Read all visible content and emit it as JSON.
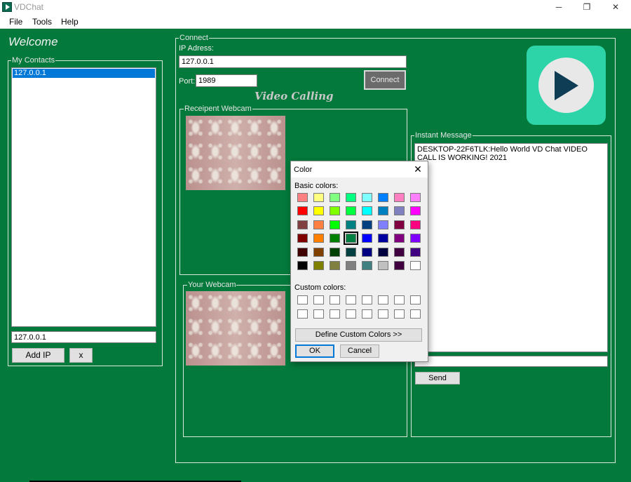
{
  "window": {
    "title": "VDChat",
    "minimize": "─",
    "maximize": "❐",
    "close": "✕"
  },
  "menu": [
    "File",
    "Tools",
    "Help"
  ],
  "welcome": "Welcome",
  "contacts": {
    "label": "My Contacts",
    "items": [
      "127.0.0.1"
    ],
    "ip_value": "127.0.0.1",
    "add_button": "Add IP",
    "remove_button": "x"
  },
  "connect": {
    "label": "Connect",
    "ip_label": "IP Adress:",
    "ip_value": "127.0.0.1",
    "port_label": "Port:",
    "port_value": "1989",
    "connect_button": "Connect",
    "video_title": "Video Calling",
    "recipient_webcam_label": "Receipent Webcam",
    "your_webcam_label": "Your Webcam"
  },
  "logo": {
    "icon": "play-icon",
    "bg_color": "#2cd4a8",
    "triangle_color": "#0f3d55"
  },
  "instant_message": {
    "label": "Instant Message",
    "text": "DESKTOP-22F6TLK:Hello World VD Chat VIDEO CALL IS WORKING! 2021",
    "input_value": "",
    "send_button": "Send"
  },
  "color_dialog": {
    "title": "Color",
    "close": "✕",
    "basic_label": "Basic colors:",
    "custom_label": "Custom colors:",
    "basic_colors": [
      [
        "#ff8080",
        "#ffff80",
        "#80ff80",
        "#00ff80",
        "#80ffff",
        "#0080ff",
        "#ff80c0",
        "#ff80ff"
      ],
      [
        "#ff0000",
        "#ffff00",
        "#80ff00",
        "#00ff40",
        "#00ffff",
        "#0080c0",
        "#8080c0",
        "#ff00ff"
      ],
      [
        "#804040",
        "#ff8040",
        "#00ff00",
        "#008080",
        "#004080",
        "#8080ff",
        "#800040",
        "#ff0080"
      ],
      [
        "#800000",
        "#ff8000",
        "#008000",
        "#008040",
        "#0000ff",
        "#0000a0",
        "#800080",
        "#8000ff"
      ],
      [
        "#400000",
        "#804000",
        "#004000",
        "#004040",
        "#000080",
        "#000040",
        "#400040",
        "#400080"
      ],
      [
        "#000000",
        "#808000",
        "#808040",
        "#808080",
        "#408080",
        "#c0c0c0",
        "#400040",
        "#ffffff"
      ]
    ],
    "selected": {
      "row": 3,
      "col": 3
    },
    "define_button": "Define Custom Colors >>",
    "ok_button": "OK",
    "cancel_button": "Cancel"
  },
  "colors": {
    "background": "#03793b",
    "selection": "#0078d7"
  }
}
